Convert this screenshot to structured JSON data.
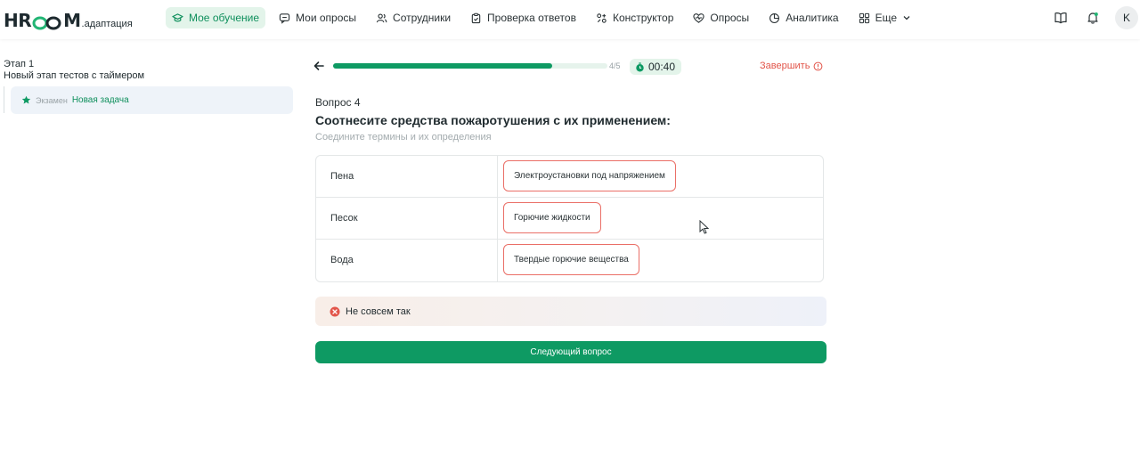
{
  "logo": {
    "main_left": "HR",
    "main_right": "M",
    "sub": ".адаптация"
  },
  "nav": {
    "items": [
      {
        "label": "Мое обучение",
        "icon": "graduation-cap-icon",
        "active": true
      },
      {
        "label": "Мои опросы",
        "icon": "chat-icon",
        "active": false
      },
      {
        "label": "Сотрудники",
        "icon": "users-icon",
        "active": false
      },
      {
        "label": "Проверка ответов",
        "icon": "clipboard-check-icon",
        "active": false
      },
      {
        "label": "Конструктор",
        "icon": "constructor-icon",
        "active": false
      },
      {
        "label": "Опросы",
        "icon": "heart-pulse-icon",
        "active": false
      },
      {
        "label": "Аналитика",
        "icon": "pie-chart-icon",
        "active": false
      },
      {
        "label": "Еще",
        "icon": "grid-icon",
        "active": false
      }
    ],
    "avatar_initial": "K"
  },
  "sidebar": {
    "stage_title": "Этап 1",
    "stage_subtitle": "Новый этап тестов с таймером",
    "item": {
      "type_label": "Экзамен",
      "name": "Новая задача"
    }
  },
  "progress": {
    "text": "4/5",
    "fraction": 0.8
  },
  "timer": {
    "value": "00:40"
  },
  "finish_label": "Завершить",
  "question": {
    "number_label": "Вопрос 4",
    "title": "Соотнесите средства пожаротушения с их применением:",
    "subtitle": "Соедините термины и их определения"
  },
  "matches": [
    {
      "term": "Пена",
      "answer": "Электроустановки под напряжением"
    },
    {
      "term": "Песок",
      "answer": "Горючие жидкости"
    },
    {
      "term": "Вода",
      "answer": "Твердые горючие вещества"
    }
  ],
  "feedback": {
    "text": "Не совсем так",
    "status_color": "#e2554a"
  },
  "next_button": {
    "label": "Следующий вопрос"
  },
  "colors": {
    "accent": "#0e9a63",
    "error": "#e2554a"
  }
}
